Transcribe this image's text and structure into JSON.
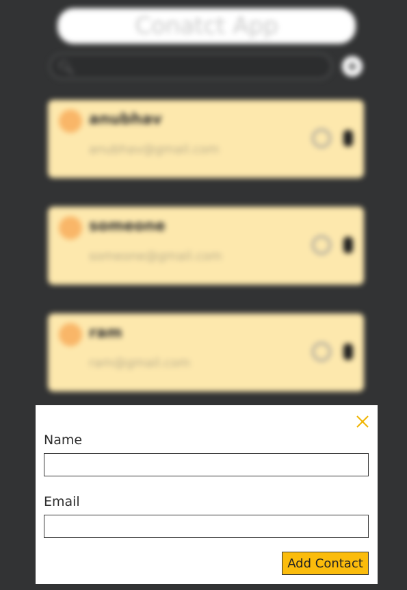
{
  "app": {
    "title": "Conatct App",
    "search": {
      "placeholder": ""
    },
    "add_icon": "+",
    "contacts": [
      {
        "name": "anubhav",
        "email": "anubhav@gmail.com"
      },
      {
        "name": "someone",
        "email": "someone@gmail.com"
      },
      {
        "name": "ram",
        "email": "ram@gmail.com"
      }
    ]
  },
  "modal": {
    "close_icon": "close-icon",
    "name_label": "Name",
    "name_value": "",
    "email_label": "Email",
    "email_value": "",
    "submit_label": "Add Contact"
  },
  "colors": {
    "background": "#323334",
    "card": "#fde8ad",
    "avatar": "#f9b668",
    "accent": "#fbbc0c"
  }
}
